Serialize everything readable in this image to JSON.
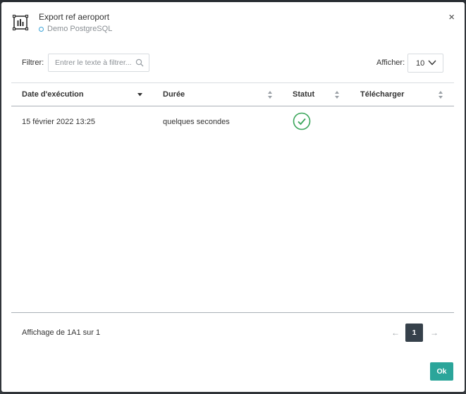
{
  "dialog": {
    "title": "Export ref aeroport",
    "subtitle": "Demo PostgreSQL",
    "close_label": "×"
  },
  "filter": {
    "label": "Filtrer:",
    "placeholder": "Entrer le texte à filtrer..."
  },
  "page_size": {
    "label": "Afficher:",
    "value": "10"
  },
  "table": {
    "columns": [
      "Date d'exécution",
      "Durée",
      "Statut",
      "Télécharger"
    ],
    "rows": [
      {
        "date": "15 février 2022 13:25",
        "duration": "quelques secondes",
        "status": "success",
        "download": ""
      }
    ]
  },
  "footer": {
    "info": "Affichage de 1A1 sur 1",
    "pager": {
      "prev": "←",
      "current": "1",
      "next": "→"
    },
    "ok_label": "Ok"
  },
  "colors": {
    "accent": "#2ba59a",
    "success": "#3aa55a",
    "pager_active": "#36414b",
    "db_dot": "#3aa3d8"
  }
}
